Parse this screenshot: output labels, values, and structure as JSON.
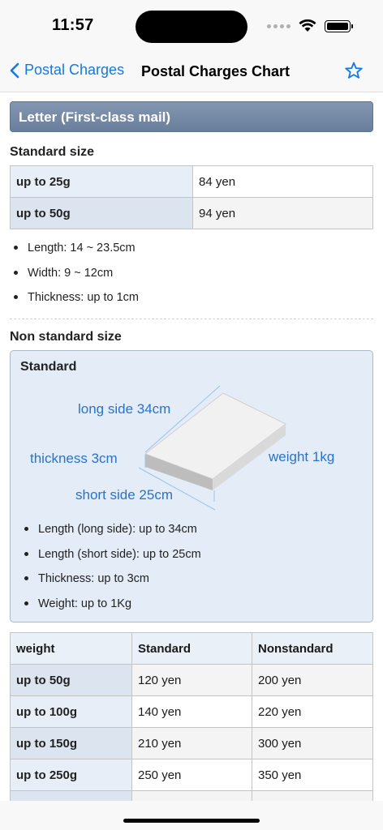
{
  "status_bar": {
    "time": "11:57"
  },
  "nav": {
    "back_label": "Postal Charges",
    "title": "Postal Charges Chart",
    "favorite_icon": "star-icon"
  },
  "letter_section": {
    "header": "Letter (First-class mail)",
    "standard_size": {
      "title": "Standard size",
      "rates": [
        {
          "weight": "up to 25g",
          "price": "84 yen"
        },
        {
          "weight": "up to 50g",
          "price": "94 yen"
        }
      ],
      "dimensions": [
        "Length: 14 ~ 23.5cm",
        "Width: 9 ~ 12cm",
        "Thickness: up to 1cm"
      ]
    },
    "non_standard_size": {
      "title": "Non standard size",
      "box_title": "Standard",
      "diagram_labels": {
        "long_side": "long side 34cm",
        "thickness": "thickness 3cm",
        "weight": "weight 1kg",
        "short_side": "short side 25cm"
      },
      "limits": [
        "Length (long side): up to 34cm",
        "Length (short side): up to 25cm",
        "Thickness: up to 3cm",
        "Weight: up to 1Kg"
      ],
      "table": {
        "headers": [
          "weight",
          "Standard",
          "Nonstandard"
        ],
        "rows": [
          [
            "up to 50g",
            "120 yen",
            "200 yen"
          ],
          [
            "up to 100g",
            "140 yen",
            "220 yen"
          ],
          [
            "up to 150g",
            "210 yen",
            "300 yen"
          ],
          [
            "up to 250g",
            "250 yen",
            "350 yen"
          ],
          [
            "",
            "",
            ""
          ]
        ]
      }
    }
  },
  "colors": {
    "accent": "#1479e3",
    "diagram_label": "#2a73c8",
    "section_header": "#7388a6"
  }
}
